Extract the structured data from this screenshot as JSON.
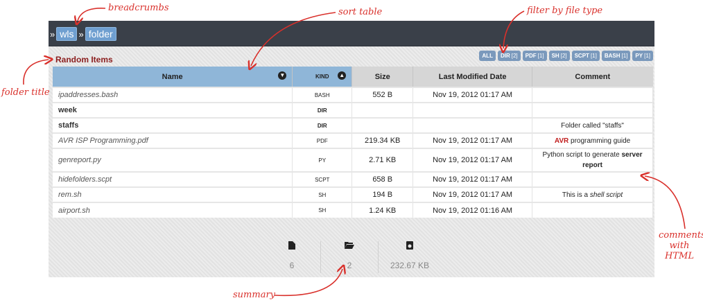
{
  "breadcrumbs": [
    "wls",
    "folder"
  ],
  "breadcrumb_separator": "»",
  "folder_title": "Random Items",
  "filters": [
    {
      "label": "ALL",
      "count": ""
    },
    {
      "label": "DIR",
      "count": "[2]"
    },
    {
      "label": "PDF",
      "count": "[1]"
    },
    {
      "label": "SH",
      "count": "[2]"
    },
    {
      "label": "SCPT",
      "count": "[1]"
    },
    {
      "label": "BASH",
      "count": "[1]"
    },
    {
      "label": "PY",
      "count": "[1]"
    }
  ],
  "table": {
    "headers": {
      "name": "Name",
      "kind": "KIND",
      "size": "Size",
      "modified": "Last Modified Date",
      "comment": "Comment"
    },
    "rows": [
      {
        "name": "ipaddresses.bash",
        "kind": "BASH",
        "size": "552 B",
        "modified": "Nov 19, 2012 01:17 AM",
        "comment": ""
      },
      {
        "name": "week",
        "kind": "DIR",
        "size": "",
        "modified": "",
        "comment": ""
      },
      {
        "name": "staffs",
        "kind": "DIR",
        "size": "",
        "modified": "",
        "comment": "Folder called \"staffs\""
      },
      {
        "name": "AVR ISP Programming.pdf",
        "kind": "PDF",
        "size": "219.34 KB",
        "modified": "Nov 19, 2012 01:17 AM",
        "comment": "AVR programming guide"
      },
      {
        "name": "genreport.py",
        "kind": "PY",
        "size": "2.71 KB",
        "modified": "Nov 19, 2012 01:17 AM",
        "comment": "Python script to generate server report"
      },
      {
        "name": "hidefolders.scpt",
        "kind": "SCPT",
        "size": "658 B",
        "modified": "Nov 19, 2012 01:17 AM",
        "comment": ""
      },
      {
        "name": "rem.sh",
        "kind": "SH",
        "size": "194 B",
        "modified": "Nov 19, 2012 01:17 AM",
        "comment": "This is a shell script"
      },
      {
        "name": "airport.sh",
        "kind": "SH",
        "size": "1.24 KB",
        "modified": "Nov 19, 2012 01:16 AM",
        "comment": ""
      }
    ],
    "comment_parts": {
      "avr_highlight": "AVR",
      "avr_rest": " programming guide",
      "py_plain": "Python script to generate ",
      "py_bold": "server report",
      "sh_plain": "This is a ",
      "sh_italic": "shell script"
    }
  },
  "summary": {
    "files_count": "6",
    "folders_count": "2",
    "total_size": "232.67 KB"
  },
  "annotations": {
    "breadcrumbs": "breadcrumbs",
    "sort_table": "sort table",
    "filter": "filter by file type",
    "folder_title": "folder title",
    "comments_line1": "comments",
    "comments_line2": "with",
    "comments_line3": "HTML",
    "summary": "summary"
  },
  "colors": {
    "accent": "#6f9fd0",
    "folder_title": "#8b1e1e",
    "annotation": "#d9302b",
    "topbar": "#3a4049"
  }
}
